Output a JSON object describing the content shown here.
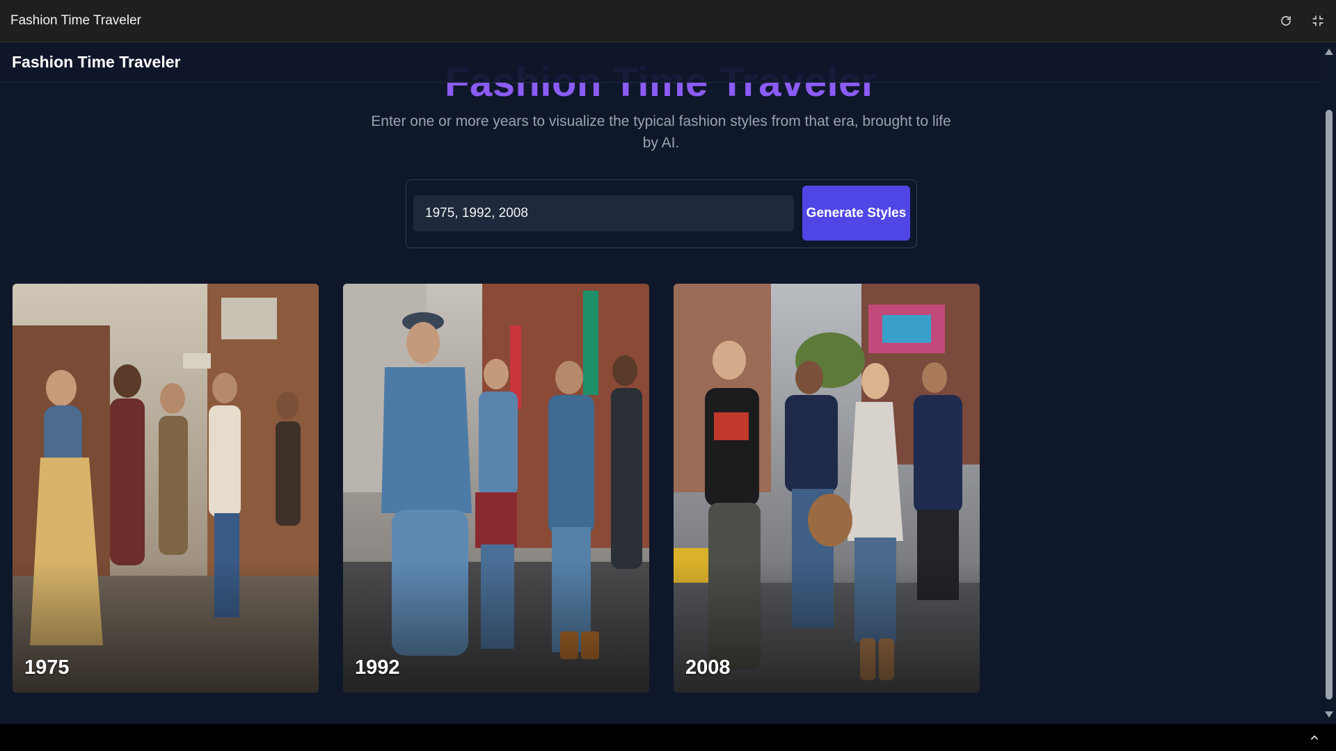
{
  "window": {
    "title": "Fashion Time Traveler",
    "reload_icon": "reload-icon",
    "fullscreen_icon": "fullscreen-icon"
  },
  "header": {
    "title": "Fashion Time Traveler"
  },
  "hero": {
    "title": "Fashion Time Traveler",
    "subtitle": "Enter one or more years to visualize the typical fashion styles from that era, brought to life by AI."
  },
  "form": {
    "years_value": "1975, 1992, 2008",
    "button_label": "Generate Styles"
  },
  "cards": [
    {
      "year": "1975"
    },
    {
      "year": "1992"
    },
    {
      "year": "2008"
    }
  ],
  "colors": {
    "background": "#0f172a",
    "accent_button": "#4f46e5",
    "hero_title": "#8b5cf6"
  }
}
